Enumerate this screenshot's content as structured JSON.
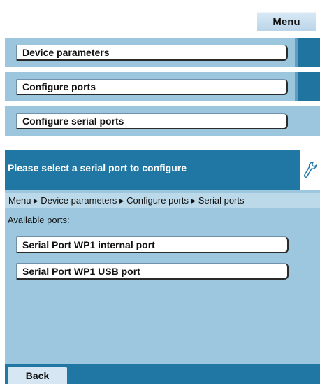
{
  "top_menu": {
    "menu_label": "Menu"
  },
  "menu_path": [
    {
      "label": "Device parameters"
    },
    {
      "label": "Configure ports"
    },
    {
      "label": "Configure serial ports"
    }
  ],
  "dialog": {
    "title": "Please select a serial port to configure",
    "icon": "wrench-icon",
    "breadcrumb": "Menu ▸ Device parameters ▸ Configure ports ▸ Serial ports",
    "available_label": "Available ports:",
    "ports": [
      {
        "label": "Serial Port WP1 internal port"
      },
      {
        "label": "Serial Port WP1 USB port"
      }
    ],
    "back_label": "Back"
  },
  "colors": {
    "header_blue": "#2077a3",
    "panel_blue": "#9dc7df",
    "breadcrumb_blue": "#bcd9ea"
  }
}
